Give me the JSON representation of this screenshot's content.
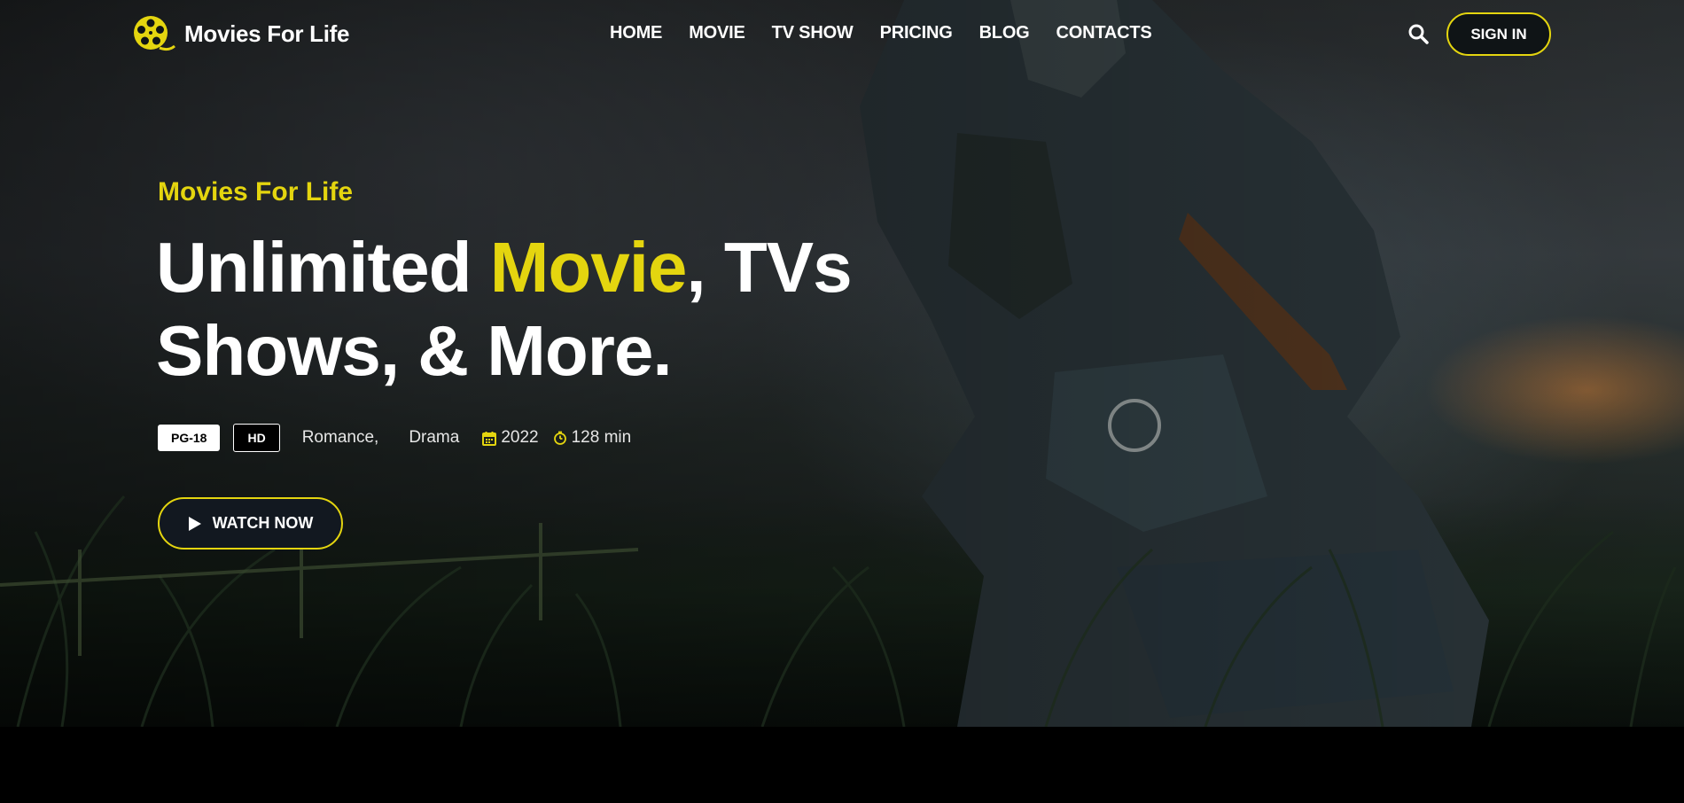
{
  "brand": {
    "name": "Movies For Life",
    "accent": "#e4d50f"
  },
  "nav": {
    "items": [
      {
        "label": "HOME"
      },
      {
        "label": "MOVIE"
      },
      {
        "label": "TV SHOW"
      },
      {
        "label": "PRICING"
      },
      {
        "label": "BLOG"
      },
      {
        "label": "CONTACTS"
      }
    ],
    "search_icon": "search-icon",
    "signin_label": "SIGN IN"
  },
  "hero": {
    "kicker": "Movies For Life",
    "headline_part1": "Unlimited ",
    "headline_accent": "Movie",
    "headline_part2": ", TVs",
    "headline_line2": "Shows, & More.",
    "rating": "PG-18",
    "quality": "HD",
    "genres": [
      "Romance,",
      "Drama"
    ],
    "year": "2022",
    "duration": "128 min",
    "year_icon": "calendar-icon",
    "duration_icon": "clock-icon",
    "cta_label": "WATCH NOW",
    "cta_icon": "play-icon"
  }
}
